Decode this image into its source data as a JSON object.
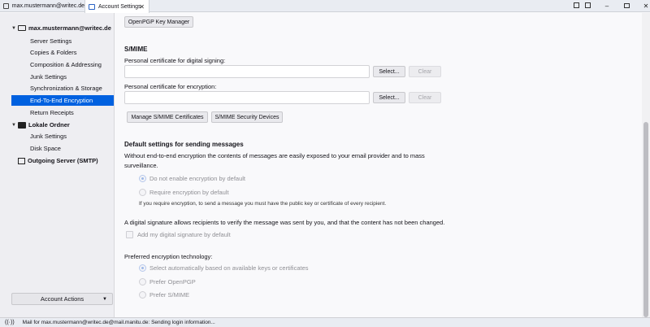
{
  "tabs": [
    {
      "label": "max.mustermann@writec.de"
    },
    {
      "label": "Account Settings"
    }
  ],
  "window_controls": {
    "minimize": "–",
    "close": "✕"
  },
  "sidebar": {
    "account": "max.mustermann@writec.de",
    "items": [
      {
        "label": "Server Settings"
      },
      {
        "label": "Copies & Folders"
      },
      {
        "label": "Composition & Addressing"
      },
      {
        "label": "Junk Settings"
      },
      {
        "label": "Synchronization & Storage"
      },
      {
        "label": "End-To-End Encryption"
      },
      {
        "label": "Return Receipts"
      }
    ],
    "local_folders": "Lokale Ordner",
    "local_items": [
      {
        "label": "Junk Settings"
      },
      {
        "label": "Disk Space"
      }
    ],
    "outgoing": "Outgoing Server (SMTP)",
    "account_actions": "Account Actions"
  },
  "main": {
    "openpgp_button": "OpenPGP Key Manager",
    "smime_title": "S/MIME",
    "signing_label": "Personal certificate for digital signing:",
    "encryption_label": "Personal certificate for encryption:",
    "select_label": "Select...",
    "clear_label": "Clear",
    "manage_smime": "Manage S/MIME Certificates",
    "smime_devices": "S/MIME Security Devices",
    "default_title": "Default settings for sending messages",
    "default_desc_1": "Without end-to-end encryption the contents of messages are easily exposed to your email provider and to mass",
    "default_desc_2": "surveillance.",
    "radio_no_encrypt": "Do not enable encryption by default",
    "radio_require": "Require encryption by default",
    "require_note": "If you require encryption, to send a message you must have the public key or certificate of every recipient.",
    "signature_desc": "A digital signature allows recipients to verify the message was sent by you, and that the content has not been changed.",
    "signature_check": "Add my digital signature by default",
    "preferred_title": "Preferred encryption technology:",
    "pref_auto": "Select automatically based on available keys or certificates",
    "pref_openpgp": "Prefer OpenPGP",
    "pref_smime": "Prefer S/MIME"
  },
  "status": {
    "text": "Mail for max.mustermann@writec.de@mail.manitu.de: Sending login information..."
  }
}
